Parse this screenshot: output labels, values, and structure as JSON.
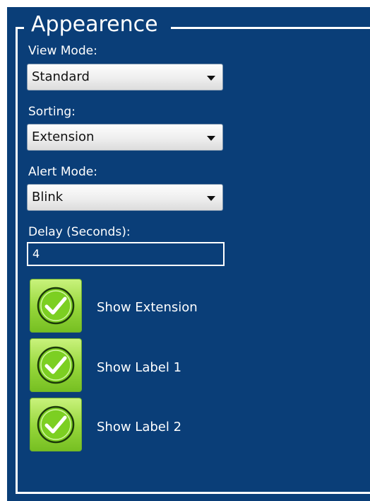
{
  "group": {
    "title": "Appearence"
  },
  "view_mode": {
    "label": "View Mode:",
    "value": "Standard",
    "icon": "chevron-down-icon"
  },
  "sorting": {
    "label": "Sorting:",
    "value": "Extension",
    "icon": "chevron-down-icon"
  },
  "alert_mode": {
    "label": "Alert Mode:",
    "value": "Blink",
    "icon": "chevron-down-icon"
  },
  "delay": {
    "label": "Delay (Seconds):",
    "value": "4"
  },
  "checkboxes": [
    {
      "label": "Show Extension",
      "checked": true,
      "icon": "checkmark-icon"
    },
    {
      "label": "Show Label 1",
      "checked": true,
      "icon": "checkmark-icon"
    },
    {
      "label": "Show Label 2",
      "checked": true,
      "icon": "checkmark-icon"
    }
  ],
  "colors": {
    "panel_background": "#0a3e78",
    "text": "#ffffff",
    "checkbox_green": "#95d63a"
  }
}
